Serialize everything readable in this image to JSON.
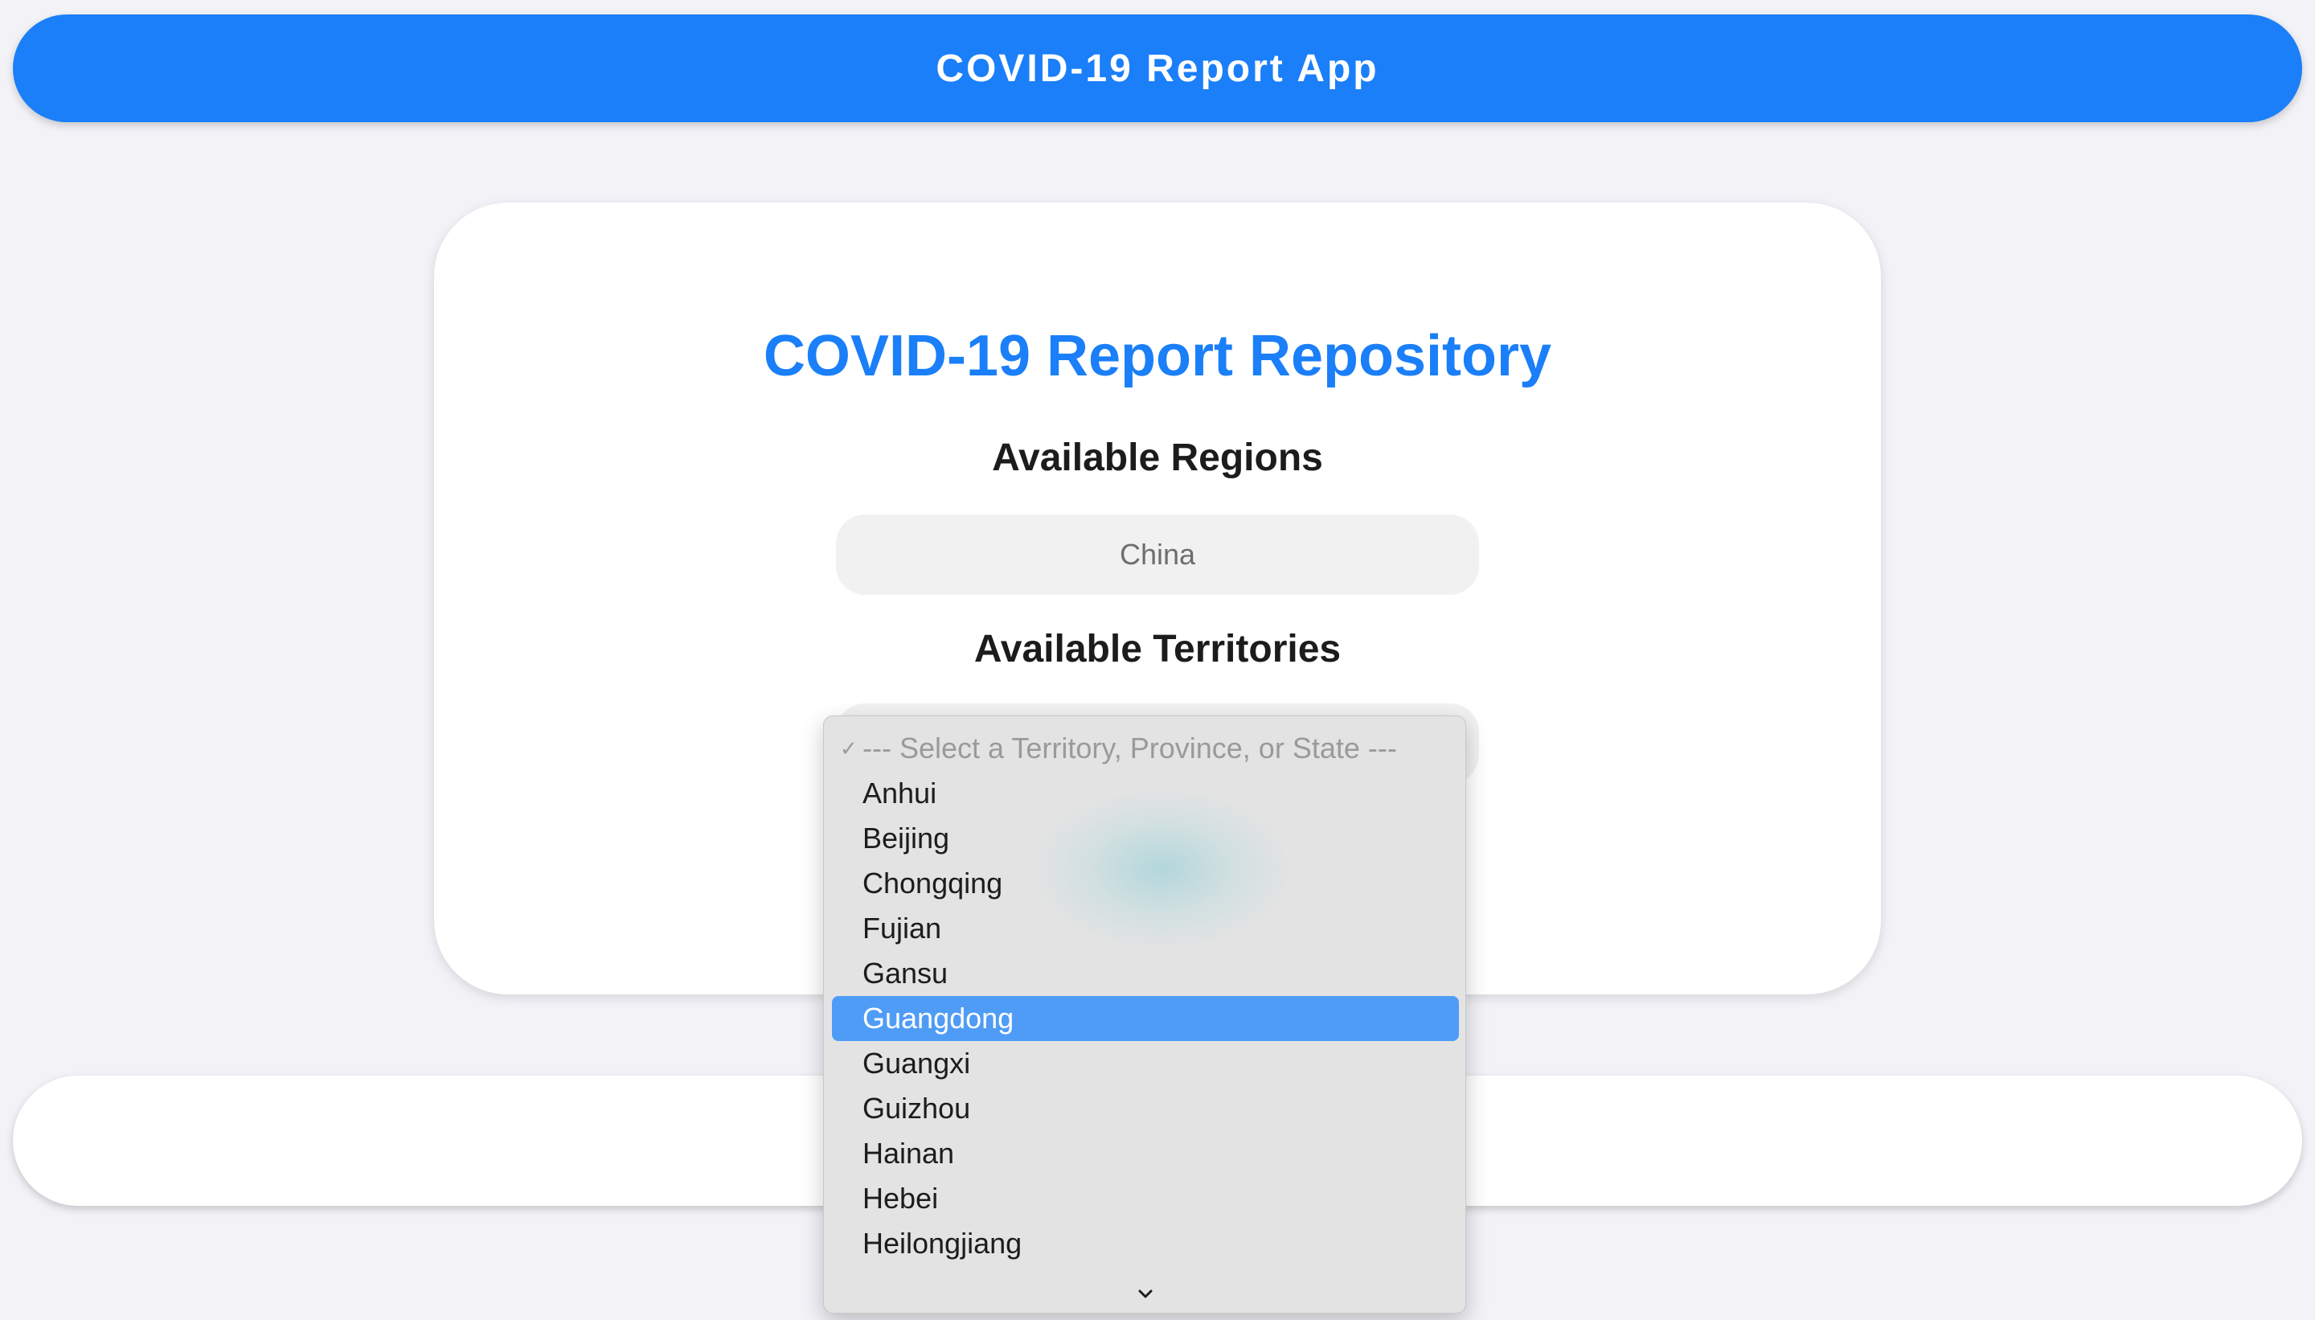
{
  "header": {
    "title": "COVID-19 Report App"
  },
  "main": {
    "title": "COVID-19 Report Repository",
    "regions_label": "Available Regions",
    "region_selected": "China",
    "territories_label": "Available Territories"
  },
  "dropdown": {
    "placeholder": "--- Select a Territory, Province, or State ---",
    "checkmark": "✓",
    "options": [
      "Anhui",
      "Beijing",
      "Chongqing",
      "Fujian",
      "Gansu",
      "Guangdong",
      "Guangxi",
      "Guizhou",
      "Hainan",
      "Hebei",
      "Heilongjiang"
    ],
    "highlighted": "Guangdong",
    "scroll_icon": "chevron-down-icon"
  },
  "colors": {
    "accent": "#1a7ff8",
    "highlight": "#4f9cf6",
    "background": "#f2f2f7"
  }
}
